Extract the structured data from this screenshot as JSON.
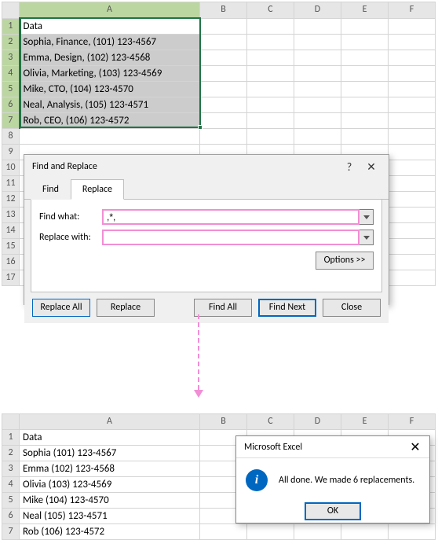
{
  "cols": [
    "A",
    "B",
    "C",
    "D",
    "E",
    "F"
  ],
  "rows_top": [
    "1",
    "2",
    "3",
    "4",
    "5",
    "6",
    "7",
    "8",
    "9",
    "10",
    "11",
    "12",
    "13",
    "14",
    "15",
    "16",
    "17"
  ],
  "rows_bottom": [
    "1",
    "2",
    "3",
    "4",
    "5",
    "6",
    "7"
  ],
  "top_data": {
    "header": "Data",
    "cells": [
      "Sophia, Finance, (101) 123-4567",
      "Emma, Design, (102) 123-4568",
      "Olivia, Marketing, (103) 123-4569",
      "Mike, CTO, (104) 123-4570",
      "Neal, Analysis, (105) 123-4571",
      "Rob, CEO, (106) 123-4572"
    ]
  },
  "bottom_data": {
    "header": "Data",
    "cells": [
      "Sophia (101) 123-4567",
      "Emma (102) 123-4568",
      "Olivia (103) 123-4569",
      "Mike (104) 123-4570",
      "Neal (105) 123-4571",
      "Rob (106) 123-4572"
    ]
  },
  "dialog": {
    "title": "Find and Replace",
    "help": "?",
    "tab_find": "Find",
    "tab_replace": "Replace",
    "find_label": "Find what:",
    "find_value": ",*,",
    "replace_label": "Replace with:",
    "replace_value": "",
    "options": "Options >>",
    "btn_replace_all": "Replace All",
    "btn_replace": "Replace",
    "btn_find_all": "Find All",
    "btn_find_next": "Find Next",
    "btn_close": "Close"
  },
  "msgbox": {
    "title": "Microsoft Excel",
    "text": "All done. We made 6 replacements.",
    "ok": "OK"
  }
}
